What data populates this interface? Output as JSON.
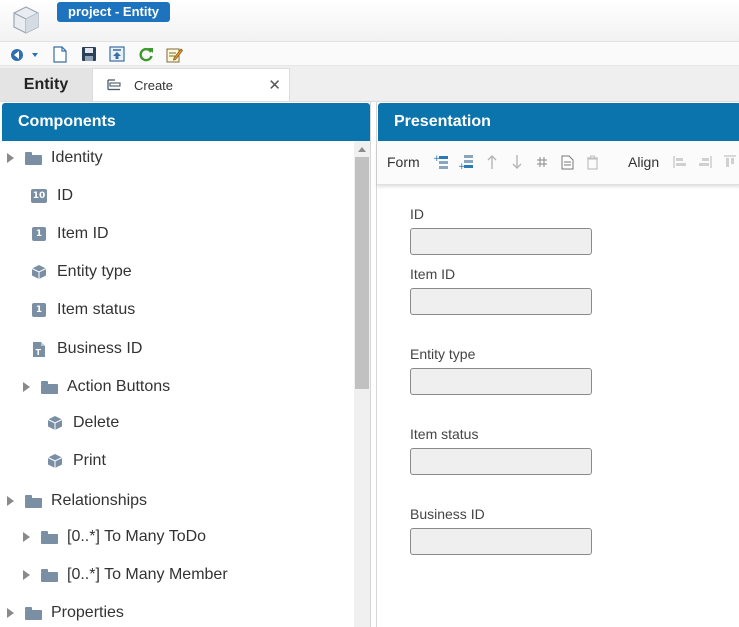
{
  "window": {
    "title": "project - Entity"
  },
  "toolbar": {
    "buttons": [
      {
        "name": "back-dropdown",
        "icon": "back-arrow-icon"
      },
      {
        "name": "new",
        "icon": "new-document-icon"
      },
      {
        "name": "save",
        "icon": "floppy-disk-icon"
      },
      {
        "name": "export",
        "icon": "export-icon"
      },
      {
        "name": "refresh",
        "icon": "refresh-icon"
      },
      {
        "name": "edit",
        "icon": "pencil-note-icon"
      }
    ]
  },
  "tabs": {
    "entity_label": "Entity",
    "create_label": "Create",
    "close_glyph": "✕"
  },
  "components": {
    "title": "Components",
    "tree": [
      {
        "label": "Identity",
        "type": "folder",
        "expander": true
      },
      {
        "label": "ID",
        "type": "badge",
        "badge": "10"
      },
      {
        "label": "Item ID",
        "type": "badge",
        "badge": "1"
      },
      {
        "label": "Entity type",
        "type": "cube"
      },
      {
        "label": "Item status",
        "type": "badge",
        "badge": "1"
      },
      {
        "label": "Business ID",
        "type": "text-doc"
      },
      {
        "label": "Action Buttons",
        "type": "folder",
        "expander": true
      },
      {
        "label": "Delete",
        "type": "cube"
      },
      {
        "label": "Print",
        "type": "cube"
      },
      {
        "label": "Relationships",
        "type": "folder",
        "expander": true
      },
      {
        "label": "[0..*] To Many ToDo",
        "type": "folder",
        "expander": true
      },
      {
        "label": "[0..*] To Many Member",
        "type": "folder",
        "expander": true
      },
      {
        "label": "Properties",
        "type": "folder",
        "expander": true
      }
    ]
  },
  "presentation": {
    "title": "Presentation",
    "toolbar": {
      "form_label": "Form",
      "align_label": "Align"
    },
    "fields": [
      {
        "label": "ID",
        "value": ""
      },
      {
        "label": "Item ID",
        "value": ""
      },
      {
        "label": "Entity type",
        "value": ""
      },
      {
        "label": "Item status",
        "value": ""
      },
      {
        "label": "Business ID",
        "value": ""
      }
    ]
  },
  "colors": {
    "header_blue": "#0b74ad",
    "title_pill": "#1e73be",
    "icon_slate": "#7a8fa4"
  }
}
